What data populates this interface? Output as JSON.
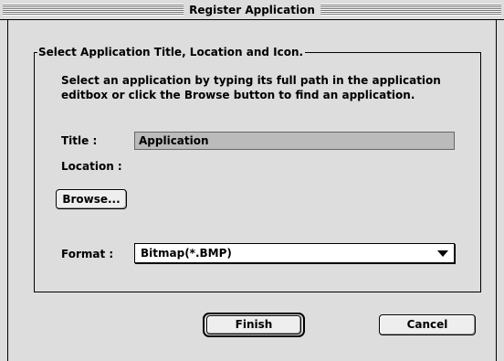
{
  "window": {
    "title": "Register Application"
  },
  "group": {
    "legend": "Select Application Title, Location and Icon.",
    "instructions": "Select an application by typing its full path in the application editbox or click the Browse button to find an application."
  },
  "fields": {
    "title_label": "Title :",
    "title_value": "Application",
    "location_label": "Location :",
    "location_value": "",
    "format_label": "Format :",
    "format_value": "Bitmap(*.BMP)"
  },
  "buttons": {
    "browse": "Browse...",
    "finish": "Finish",
    "cancel": "Cancel"
  },
  "icons": {
    "dropdown": "chevron-down-icon"
  },
  "colors": {
    "window_bg": "#dddddd",
    "field_bg": "#bbbbbb"
  }
}
